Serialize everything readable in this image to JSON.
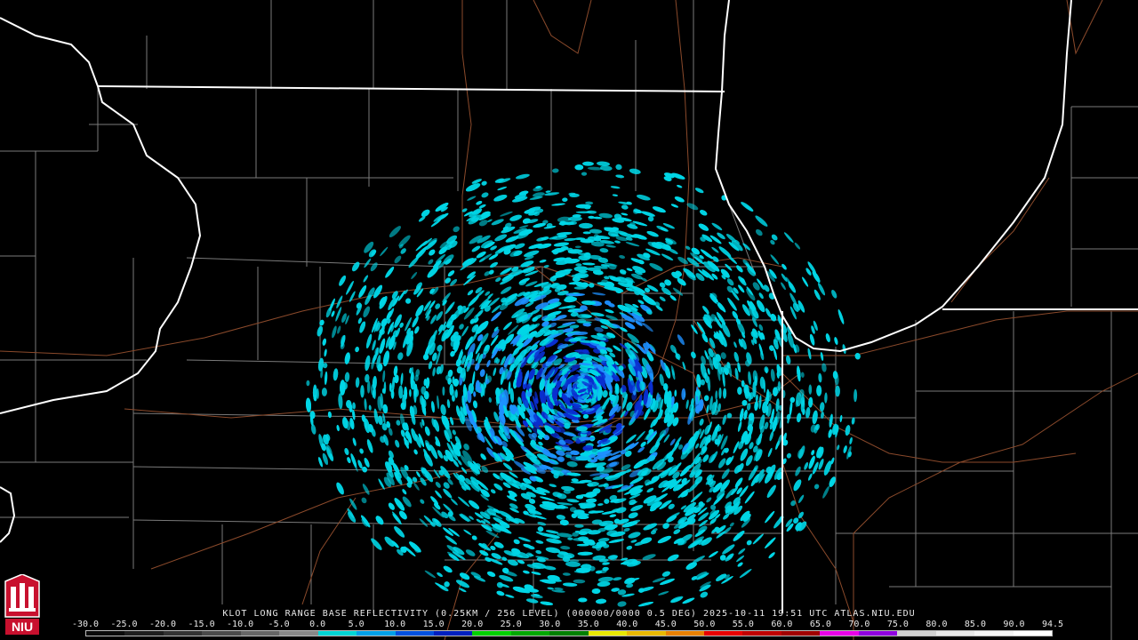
{
  "product": {
    "caption": "KLOT LONG RANGE BASE REFLECTIVITY (0.25KM / 256 LEVEL) (000000/0000 0.5 DEG) 2025-10-11 19:51 UTC  ATLAS.NIU.EDU"
  },
  "scale": {
    "labels": [
      "-30.0",
      "-25.0",
      "-20.0",
      "-15.0",
      "-10.0",
      "-5.0",
      "0.0",
      "5.0",
      "10.0",
      "15.0",
      "20.0",
      "25.0",
      "30.0",
      "35.0",
      "40.0",
      "45.0",
      "50.0",
      "55.0",
      "60.0",
      "65.0",
      "70.0",
      "75.0",
      "80.0",
      "85.0",
      "90.0",
      "94.5"
    ],
    "colors": [
      "#0a0a0a",
      "#1e1e1e",
      "#333333",
      "#4a4a4a",
      "#666666",
      "#888888",
      "#00d6d6",
      "#00a0e8",
      "#0050e0",
      "#0020c0",
      "#00d000",
      "#00a800",
      "#008000",
      "#e8e800",
      "#e8b800",
      "#e88000",
      "#e80000",
      "#c00000",
      "#a00000",
      "#e800e8",
      "#9000e0",
      "#d0d0d0",
      "#e8e8e8",
      "#f4f4f4",
      "#ffffff"
    ]
  },
  "logo": {
    "text": "NIU"
  },
  "colors": {
    "background": "#000000",
    "state_border": "#ffffff",
    "county_border": "#7a7a7a",
    "roads": "#8b4a2b",
    "echo_light": "#00d6e6",
    "echo_mid": "#1e90ff",
    "echo_dark": "#0a2fd0"
  }
}
